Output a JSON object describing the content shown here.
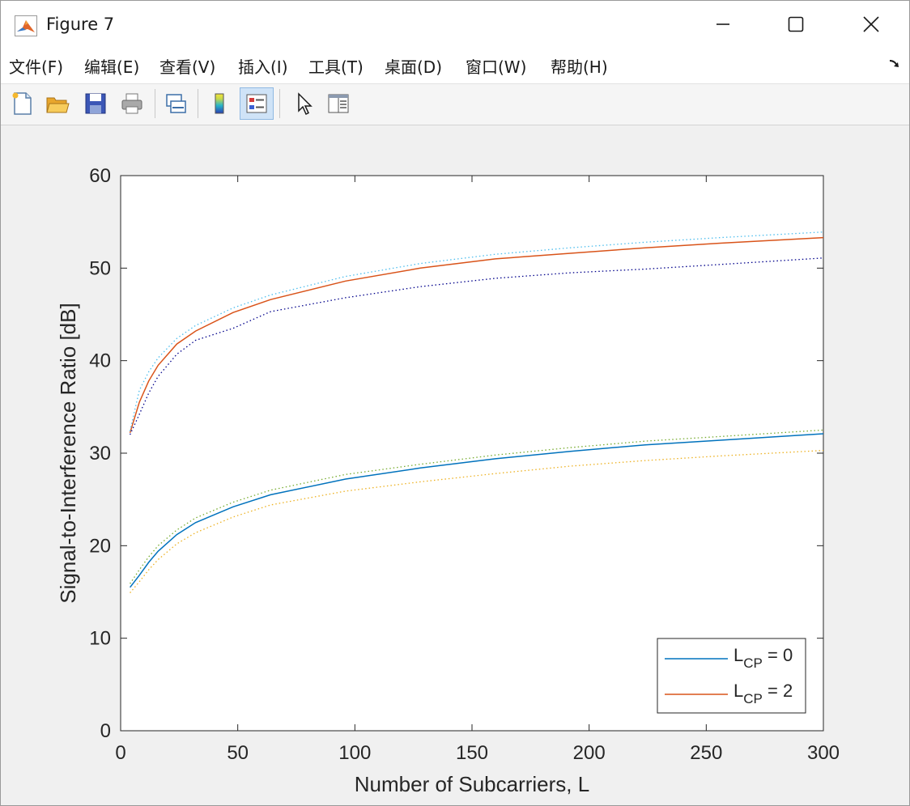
{
  "window": {
    "title": "Figure 7",
    "minimize_label": "—",
    "maximize_label": "☐",
    "close_label": "✕"
  },
  "menubar": {
    "items": [
      {
        "label": "文件(F)"
      },
      {
        "label": "编辑(E)"
      },
      {
        "label": "查看(V)"
      },
      {
        "label": "插入(I)"
      },
      {
        "label": "工具(T)"
      },
      {
        "label": "桌面(D)"
      },
      {
        "label": "窗口(W)"
      },
      {
        "label": "帮助(H)"
      }
    ]
  },
  "toolbar": {
    "icons": [
      "new-figure-icon",
      "open-file-icon",
      "save-icon",
      "print-icon",
      "link-plot-icon",
      "insert-colorbar-icon",
      "insert-legend-icon",
      "edit-plot-icon",
      "property-inspector-icon"
    ],
    "active": "insert-legend-icon"
  },
  "chart_data": {
    "type": "line",
    "title": "",
    "xlabel": "Number of Subcarriers, L",
    "ylabel": "Signal-to-Interference Ratio [dB]",
    "xlim": [
      0,
      300
    ],
    "ylim": [
      0,
      60
    ],
    "xticks": [
      "0",
      "50",
      "100",
      "150",
      "200",
      "250",
      "300"
    ],
    "yticks": [
      "0",
      "10",
      "20",
      "30",
      "40",
      "50",
      "60"
    ],
    "grid": false,
    "legend_position": "bottom-right",
    "legend": [
      {
        "main": "L",
        "sub": "CP",
        "rest": " = 0",
        "color": "#0072BD"
      },
      {
        "main": "L",
        "sub": "CP",
        "rest": " = 2",
        "color": "#D95319"
      }
    ],
    "x": [
      4,
      8,
      12,
      16,
      24,
      32,
      48,
      64,
      96,
      128,
      160,
      192,
      224,
      256,
      300
    ],
    "series": [
      {
        "name": "L_CP = 0",
        "style": "solid",
        "color": "#0072BD",
        "values": [
          15.5,
          16.8,
          18.2,
          19.4,
          21.2,
          22.5,
          24.2,
          25.5,
          27.2,
          28.4,
          29.4,
          30.2,
          30.9,
          31.4,
          32.1
        ]
      },
      {
        "name": "L_CP = 2",
        "style": "solid",
        "color": "#D95319",
        "values": [
          32.2,
          35.5,
          37.8,
          39.5,
          41.8,
          43.2,
          45.2,
          46.6,
          48.6,
          50.0,
          51.0,
          51.6,
          52.2,
          52.7,
          53.3
        ]
      },
      {
        "style": "dotted",
        "color": "#4DBEEE",
        "values": [
          32.4,
          36.8,
          38.8,
          40.3,
          42.4,
          43.8,
          45.7,
          47.1,
          49.1,
          50.5,
          51.5,
          52.2,
          52.8,
          53.3,
          53.9
        ]
      },
      {
        "style": "dotted",
        "color": "#00008B",
        "values": [
          32.0,
          34.2,
          36.5,
          38.3,
          40.7,
          42.2,
          43.5,
          45.3,
          46.8,
          48.0,
          48.9,
          49.5,
          49.9,
          50.4,
          51.1
        ]
      },
      {
        "style": "dotted",
        "color": "#77AC30",
        "values": [
          15.9,
          17.4,
          18.8,
          20.0,
          21.7,
          23.0,
          24.7,
          26.0,
          27.7,
          28.8,
          29.8,
          30.6,
          31.3,
          31.8,
          32.5
        ]
      },
      {
        "style": "dotted",
        "color": "#EDB120",
        "values": [
          14.9,
          16.1,
          17.4,
          18.5,
          20.2,
          21.4,
          23.1,
          24.4,
          25.9,
          26.9,
          27.8,
          28.6,
          29.2,
          29.7,
          30.3
        ]
      }
    ]
  }
}
